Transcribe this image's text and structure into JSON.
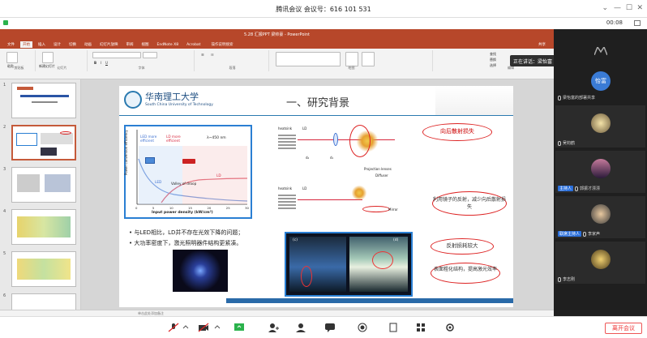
{
  "meeting": {
    "title": "腾讯会议 会议号：616 101 531",
    "timer": "00:08"
  },
  "ppt": {
    "file_title": "5.28 汇报PPT 梁帅豪 - PowerPoint",
    "tabs": [
      "文件",
      "开始",
      "插入",
      "设计",
      "切换",
      "动画",
      "幻灯片放映",
      "审阅",
      "视图",
      "EndNote X8",
      "Acrobat",
      "操作说明"
    ],
    "active_tab": "开始",
    "tellme": "操作说明搜索",
    "share_label": "共享",
    "ribbon_groups": [
      "剪贴板",
      "幻灯片",
      "字体",
      "段落",
      "绘图",
      "编辑"
    ],
    "ribbon_items": {
      "paste": "粘贴",
      "new_slide": "新建幻灯片",
      "find": "查找",
      "replace": "替换",
      "select": "选择"
    },
    "notes_hint": "单击此处添加备注",
    "thumb_numbers": [
      "1",
      "2",
      "3",
      "4",
      "5",
      "6"
    ]
  },
  "slide": {
    "school_cn": "华南理工大学",
    "school_en": "South China University of Technology",
    "heading": "一、研究背景",
    "chart": {
      "ylabel": "Power conversion efficiency",
      "xlabel": "Input power density (kW/cm²)",
      "x_ticks": [
        "0",
        "5",
        "10",
        "15",
        "20",
        "25",
        "30"
      ],
      "led_label": "LED more efficient",
      "ld_label": "LD more efficient",
      "wavelength": "λ~450 nm",
      "valley_label": "Valley of droop",
      "led_curve": "LED",
      "ld_curve": "LD"
    },
    "diagram": {
      "heatsink": "heatsink",
      "ld": "LD",
      "projection": "Projection lenses",
      "diffuser": "Diffuser",
      "mirror": "Mirror",
      "d1": "d₁",
      "d2": "d₂"
    },
    "callouts": [
      "向后散射损失",
      "利用镜子的反射，减少向后散射损失",
      "反射损耗较大",
      "表面粗化结构，提高激光效率"
    ],
    "bullets": [
      "与LED相比，LD并不存在光效下降的问题；",
      "大功率密度下，激光照明器件结构更紧凑。"
    ],
    "photo_labels": [
      "(c)",
      "(d)"
    ]
  },
  "participants": {
    "speaking": "正在讲话：梁怡富",
    "list": [
      {
        "name": "梁怡富",
        "role": "",
        "avatar_text": "怡富"
      },
      {
        "name": "梁怡富的部署共享",
        "role": ""
      },
      {
        "name": "吴钧鹤",
        "role": ""
      },
      {
        "name": "郭振才漂漂",
        "role": "主持人"
      },
      {
        "name": "李家声",
        "role": "联席主持人"
      },
      {
        "name": "李志刚",
        "role": ""
      }
    ]
  },
  "controls": {
    "leave": "离开会议"
  }
}
